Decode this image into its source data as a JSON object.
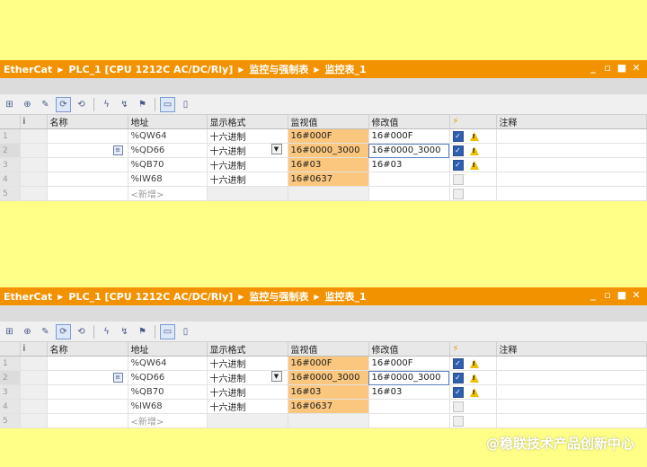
{
  "title_crumbs": [
    "EtherCat",
    "PLC_1 [CPU 1212C AC/DC/Rly]",
    "监控与强制表",
    "监控表_1"
  ],
  "window_controls": [
    "_",
    "▫",
    "■",
    "✕"
  ],
  "toolbar_icons": [
    "insert-row-icon",
    "add-row-icon",
    "rename-icon",
    "monitor-all-icon",
    "monitor-once-icon",
    "modify-now-icon",
    "modify-trigger-icon",
    "force-icon",
    "show-extended-icon",
    "show-modify-icon"
  ],
  "columns": {
    "index": "",
    "info": "i",
    "name": "名称",
    "address": "地址",
    "format": "显示格式",
    "monitor": "监视值",
    "modify": "修改值",
    "flag": "⚡",
    "comment": "注释"
  },
  "rows": [
    {
      "num": "1",
      "address": "%QW64",
      "format": "十六进制",
      "monitor": "16#000F",
      "modify": "16#000F",
      "checked": true,
      "warn": true
    },
    {
      "num": "2",
      "address": "%QD66",
      "format": "十六进制",
      "monitor": "16#0000_3000",
      "modify": "16#0000_3000",
      "checked": true,
      "warn": true
    },
    {
      "num": "3",
      "address": "%QB70",
      "format": "十六进制",
      "monitor": "16#03",
      "modify": "16#03",
      "checked": true,
      "warn": true
    },
    {
      "num": "4",
      "address": "%IW68",
      "format": "十六进制",
      "monitor": "16#0637",
      "modify": "",
      "checked": false,
      "warn": false
    },
    {
      "num": "5",
      "address": "<新增>",
      "format": "",
      "monitor": "",
      "modify": "",
      "checked": false,
      "warn": false
    }
  ],
  "watermark": "@稳联技术产品创新中心",
  "colors": {
    "accent": "#f39200",
    "monitor_bg": "#fbc77e",
    "background": "#ffff88"
  }
}
